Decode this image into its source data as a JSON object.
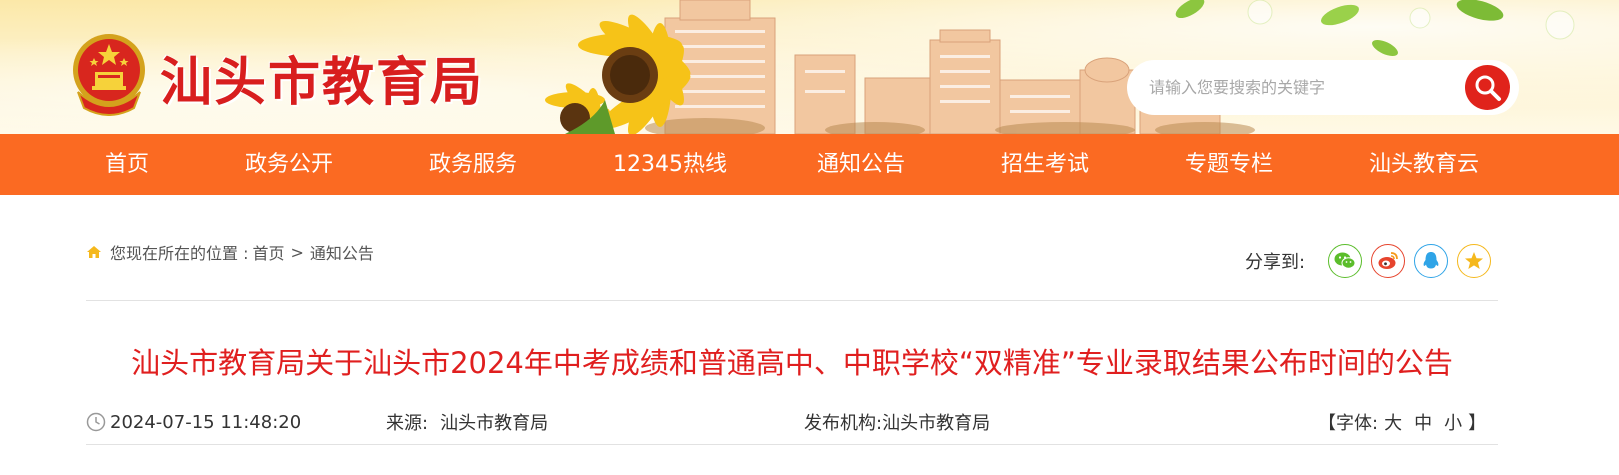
{
  "header": {
    "site_title": "汕头市教育局",
    "search_placeholder": "请输入您要搜索的关键字",
    "emblem_icon": "national-emblem-icon",
    "search_icon": "search-icon"
  },
  "nav": {
    "items": [
      {
        "label": "首页"
      },
      {
        "label": "政务公开"
      },
      {
        "label": "政务服务"
      },
      {
        "label": "12345热线"
      },
      {
        "label": "通知公告"
      },
      {
        "label": "招生考试"
      },
      {
        "label": "专题专栏"
      },
      {
        "label": "汕头教育云"
      }
    ]
  },
  "breadcrumb": {
    "prefix": "您现在所在的位置 :",
    "items": [
      "首页",
      "通知公告"
    ],
    "separator": ">",
    "icon": "home-icon"
  },
  "share": {
    "label": "分享到:",
    "buttons": [
      {
        "icon": "wechat-icon",
        "color": "#5bbd2b"
      },
      {
        "icon": "weibo-icon",
        "color": "#e6442d"
      },
      {
        "icon": "qq-icon",
        "color": "#2fa4e7"
      },
      {
        "icon": "qzone-star-icon",
        "color": "#f5b81c"
      }
    ]
  },
  "article": {
    "title": "汕头市教育局关于汕头市2024年中考成绩和普通高中、中职学校“双精准”专业录取结果公布时间的公告",
    "datetime": "2024-07-15 11:48:20",
    "source_label": "来源:",
    "source": "汕头市教育局",
    "publisher_label": "发布机构:",
    "publisher": "汕头市教育局",
    "font_size_label": "【字体:",
    "font_sizes": [
      "大",
      "中",
      "小"
    ],
    "font_size_close": "】"
  },
  "colors": {
    "nav_bg": "#fb6a22",
    "title_red": "#e01f1f",
    "brand_red": "#d81e1e"
  }
}
